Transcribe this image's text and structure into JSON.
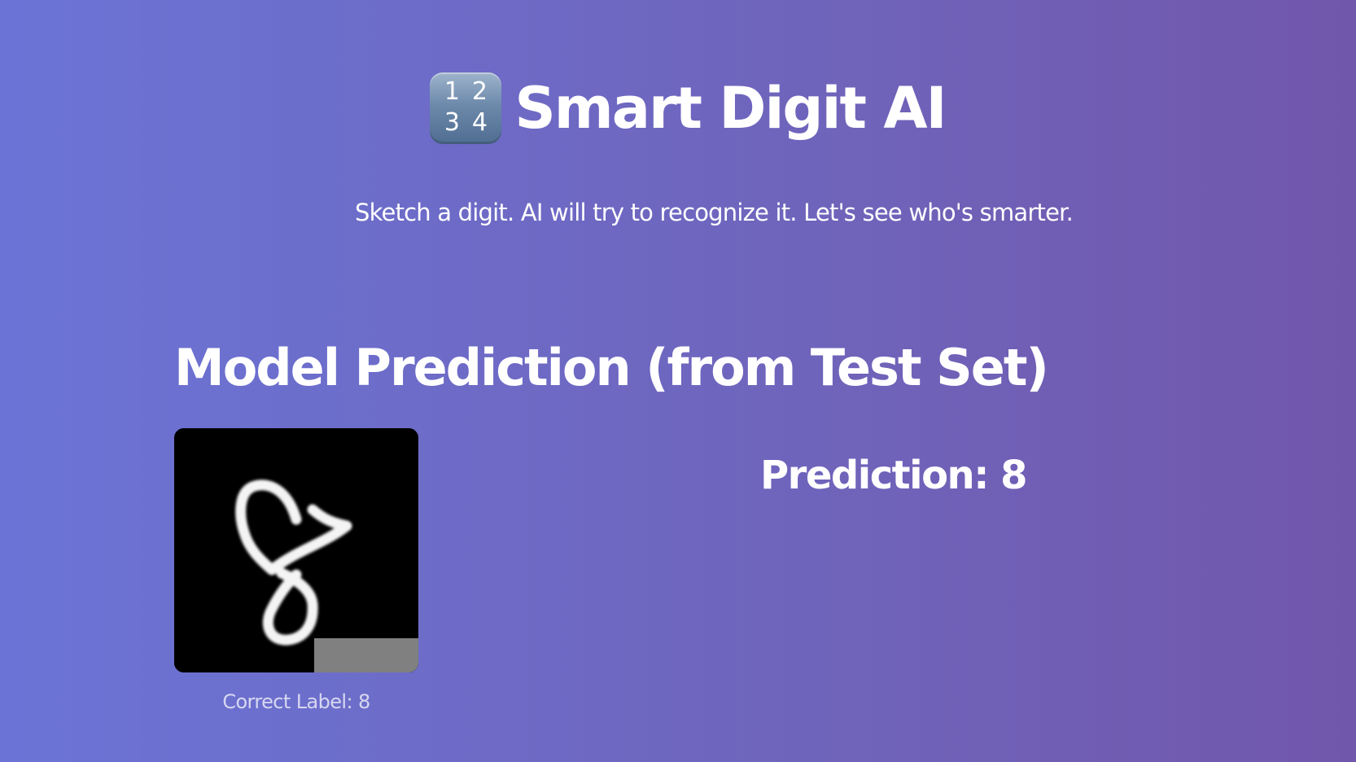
{
  "header": {
    "icon": "input-numbers-icon",
    "icon_digits": [
      "1",
      "2",
      "3",
      "4"
    ],
    "title": "Smart Digit AI"
  },
  "subtitle": "Sketch a digit. AI will try to recognize it. Let's see who's smarter.",
  "section": {
    "title": "Model Prediction (from Test Set)",
    "correct_label": "Correct Label: 8",
    "prediction": "Prediction: 8"
  },
  "colors": {
    "background_start": "#6b74d6",
    "background_end": "#7157ac",
    "text": "#ffffff"
  }
}
